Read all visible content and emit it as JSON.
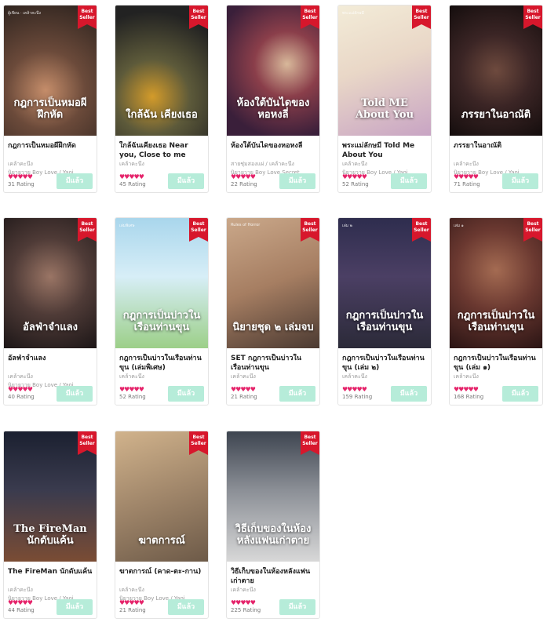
{
  "badge": {
    "line1": "Best",
    "line2": "Seller"
  },
  "colors": {
    "badge": "#d7172c",
    "hearts": "#e5236a",
    "button": "#b6ecd9"
  },
  "books": [
    {
      "title": "กฎการเป็นหมอผีฝึกหัด",
      "meta1": "เคล้าคะนึง",
      "meta2": "นิยายวาย Boy Love / Yaoi",
      "hearts": "♥♥♥♥♥",
      "rating": "31 Rating",
      "button": "มีแล้ว",
      "cover_text": "กฎการเป็นหมอผีฝึกหัด",
      "cover_small": "ผู้เขียน · เคล้าคะนึง"
    },
    {
      "title": "ใกล้ฉันเคียงเธอ Near you, Close to me",
      "meta1": "เคล้าคะนึง",
      "meta2": "",
      "hearts": "♥♥♥♥♥",
      "rating": "45 Rating",
      "button": "มีแล้ว",
      "cover_text": "ใกล้ฉัน เคียงเธอ",
      "cover_small": ""
    },
    {
      "title": "ห้องใต้บันไดของหอหงลี่",
      "meta1": "สายชุ่มสองแผ่ / เคล้าคะนึง",
      "meta2": "นิยายวาย Boy Love Secret",
      "hearts": "♥♥♥♥♥",
      "rating": "22 Rating",
      "button": "มีแล้ว",
      "cover_text": "ห้องใต้บันไดของหอหงลี่",
      "cover_small": ""
    },
    {
      "title": "พระแม่ลักษมี Told Me About You",
      "meta1": "เคล้าคะนึง",
      "meta2": "นิยายวาย Boy Love / Yaoi",
      "hearts": "♥♥♥♥♥",
      "rating": "52 Rating",
      "button": "มีแล้ว",
      "cover_text": "Told ME About You",
      "cover_small": "พระแม่ลักษมี"
    },
    {
      "title": "ภรรยาในอาณัติ",
      "meta1": "เคล้าคะนึง",
      "meta2": "นิยายวาย Boy Love / Yaoi",
      "hearts": "♥♥♥♥♥",
      "rating": "71 Rating",
      "button": "มีแล้ว",
      "cover_text": "ภรรยาในอาณัติ",
      "cover_small": ""
    },
    {
      "title": "อัลฟ่าจำแลง",
      "meta1": "เคล้าคะนึง",
      "meta2": "นิยายวาย Boy Love / Yaoi",
      "hearts": "♥♥♥♥♥",
      "rating": "40 Rating",
      "button": "มีแล้ว",
      "cover_text": "อัลฟ่าจำแลง",
      "cover_small": ""
    },
    {
      "title": "กฎการเป็นบ่าวในเรือนท่านขุน (เล่มพิเศษ)",
      "meta1": "เคล้าคะนึง",
      "meta2": "",
      "hearts": "♥♥♥♥♥",
      "rating": "52 Rating",
      "button": "มีแล้ว",
      "cover_text": "กฎการเป็นบ่าวในเรือนท่านขุน",
      "cover_small": "เล่มพิเศษ"
    },
    {
      "title": "SET กฎการเป็นบ่าวในเรือนท่านขุน",
      "meta1": "เคล้าคะนึง",
      "meta2": "",
      "hearts": "♥♥♥♥♥",
      "rating": "21 Rating",
      "button": "มีแล้ว",
      "cover_text": "นิยายชุด ๒ เล่มจบ",
      "cover_small": "Rules of Horror"
    },
    {
      "title": "กฎการเป็นบ่าวในเรือนท่านขุน (เล่ม ๒)",
      "meta1": "เคล้าคะนึง",
      "meta2": "",
      "hearts": "♥♥♥♥♥",
      "rating": "159 Rating",
      "button": "มีแล้ว",
      "cover_text": "กฎการเป็นบ่าวในเรือนท่านขุน",
      "cover_small": "เล่ม ๒"
    },
    {
      "title": "กฎการเป็นบ่าวในเรือนท่านขุน (เล่ม ๑)",
      "meta1": "เคล้าคะนึง",
      "meta2": "",
      "hearts": "♥♥♥♥♥",
      "rating": "168 Rating",
      "button": "มีแล้ว",
      "cover_text": "กฎการเป็นบ่าวในเรือนท่านขุน",
      "cover_small": "เล่ม ๑"
    },
    {
      "title": "The FireMan นักดับแค้น",
      "meta1": "เคล้าคะนึง",
      "meta2": "นิยายวาย Boy Love / Yaoi",
      "hearts": "♥♥♥♥♥",
      "rating": "44 Rating",
      "button": "มีแล้ว",
      "cover_text": "The FireMan นักดับแค้น",
      "cover_small": ""
    },
    {
      "title": "ฆาตการณ์ (คาด-ตะ-กาน)",
      "meta1": "เคล้าคะนึง",
      "meta2": "นิยายวาย Boy Love / Yaoi",
      "hearts": "♥♥♥♥♥",
      "rating": "21 Rating",
      "button": "มีแล้ว",
      "cover_text": "ฆาตการณ์",
      "cover_small": ""
    },
    {
      "title": "วิธีเก็บของในห้องหลังแฟนเก่าตาย",
      "meta1": "เคล้าคะนึง",
      "meta2": "",
      "hearts": "♥♥♥♥♥",
      "rating": "225 Rating",
      "button": "มีแล้ว",
      "cover_text": "วิธีเก็บของในห้องหลังแฟนเก่าตาย",
      "cover_small": ""
    }
  ]
}
